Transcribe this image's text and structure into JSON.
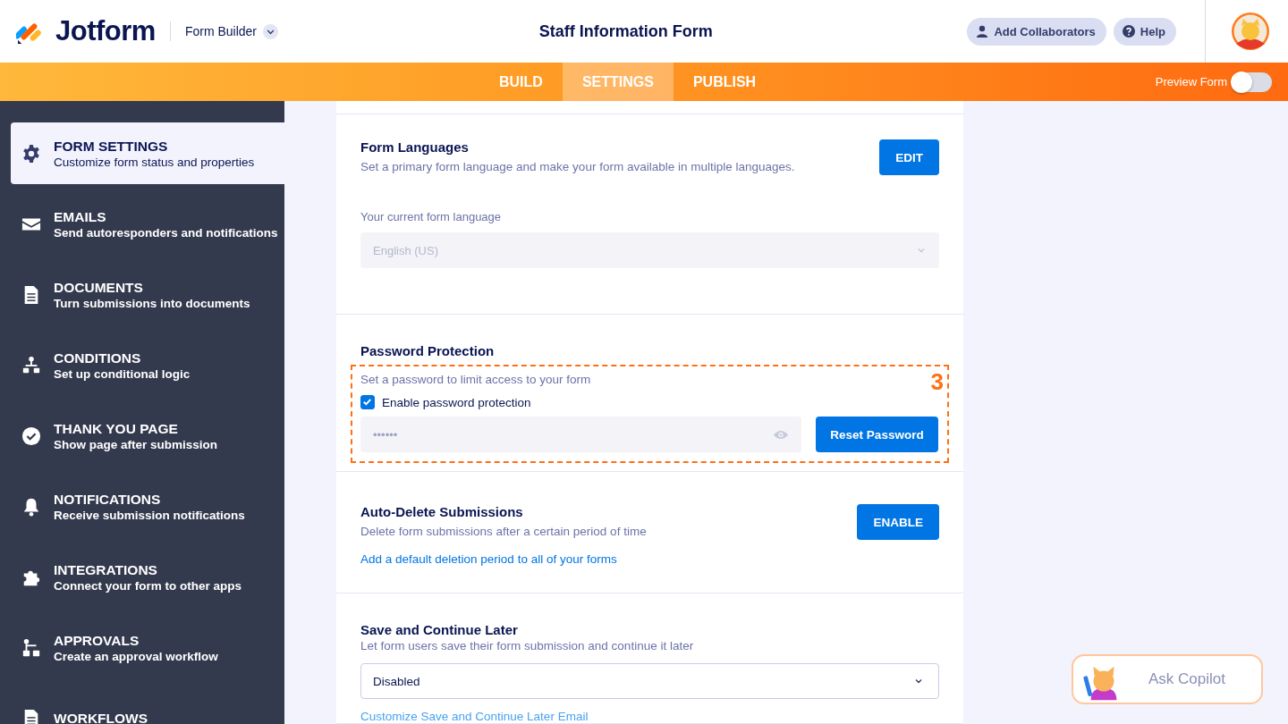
{
  "header": {
    "logo": "Jotform",
    "product": "Form Builder",
    "title": "Staff Information Form",
    "buttons": [
      {
        "kind": "user",
        "label": "Add Collaborators"
      },
      {
        "kind": "help",
        "label": "Help"
      }
    ]
  },
  "nav": {
    "tabs": [
      {
        "label": "BUILD",
        "selected": false
      },
      {
        "label": "SETTINGS",
        "selected": true
      },
      {
        "label": "PUBLISH",
        "selected": false
      }
    ],
    "preview": {
      "label": "Preview Form",
      "on": false
    }
  },
  "sidebar": {
    "items": [
      {
        "title": "FORM SETTINGS",
        "subtitle": "Customize form status and properties",
        "selected": true
      },
      {
        "title": "EMAILS",
        "subtitle": "Send autoresponders and notifications",
        "selected": false
      },
      {
        "title": "DOCUMENTS",
        "subtitle": "Turn submissions into documents",
        "selected": false
      },
      {
        "title": "CONDITIONS",
        "subtitle": "Set up conditional logic",
        "selected": false
      },
      {
        "title": "THANK YOU PAGE",
        "subtitle": "Show page after submission",
        "selected": false
      },
      {
        "title": "NOTIFICATIONS",
        "subtitle": "Receive submission notifications",
        "selected": false
      },
      {
        "title": "INTEGRATIONS",
        "subtitle": "Connect your form to other apps",
        "selected": false
      },
      {
        "title": "APPROVALS",
        "subtitle": "Create an approval workflow",
        "selected": false
      },
      {
        "title": "WORKFLOWS",
        "selected": false
      }
    ]
  },
  "sections": [
    {
      "kind": "language",
      "title": "Form Languages",
      "description": "Set a primary form language and make your form available in multiple languages.",
      "button": "EDIT",
      "field_label": "Your current form language",
      "value": "English (US)"
    },
    {
      "kind": "password",
      "title": "Password Protection",
      "description": "Set a password to limit access to your form",
      "checkbox": {
        "label": "Enable password protection",
        "checked": true
      },
      "password": "••••••",
      "button": "Reset Password",
      "annotation": "3"
    },
    {
      "kind": "autodelete",
      "title": "Auto-Delete Submissions",
      "description": "Delete form submissions after a certain period of time",
      "button": "ENABLE",
      "link": "Add a default deletion period to all of your forms"
    },
    {
      "kind": "save",
      "title": "Save and Continue Later",
      "description": "Let form users save their form submission and continue it later",
      "value": "Disabled",
      "link": "Customize Save and Continue Later Email"
    }
  ],
  "copilot": {
    "label": "Ask Copilot"
  }
}
